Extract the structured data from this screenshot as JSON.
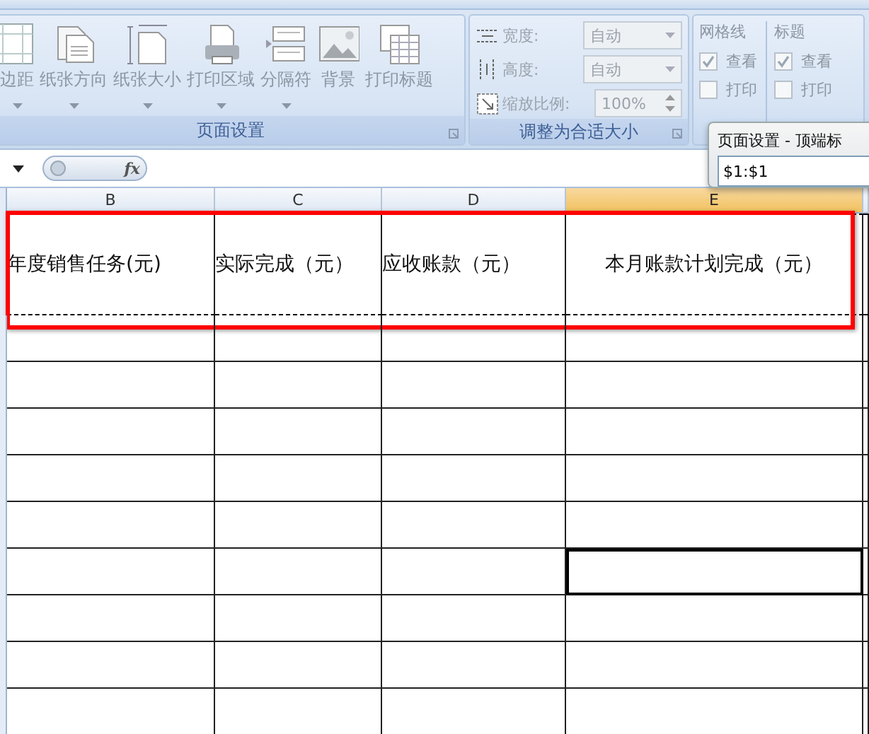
{
  "ribbon": {
    "page_setup": {
      "title": "页面设置",
      "buttons": [
        {
          "label": "边距",
          "dropdown": true
        },
        {
          "label": "纸张方向",
          "dropdown": true
        },
        {
          "label": "纸张大小",
          "dropdown": true
        },
        {
          "label": "打印区域",
          "dropdown": true
        },
        {
          "label": "分隔符",
          "dropdown": true
        },
        {
          "label": "背景",
          "dropdown": false
        },
        {
          "label": "打印标题",
          "dropdown": false
        }
      ]
    },
    "scale_to_fit": {
      "title": "调整为合适大小",
      "rows": [
        {
          "label": "宽度:",
          "value": "自动",
          "kind": "dropdown",
          "disabled": true
        },
        {
          "label": "高度:",
          "value": "自动",
          "kind": "dropdown",
          "disabled": true
        },
        {
          "label": "缩放比例:",
          "value": "100%",
          "kind": "spinner",
          "disabled": true
        }
      ]
    },
    "sheet_options": [
      {
        "title": "网格线",
        "options": [
          {
            "label": "查看",
            "checked": true
          },
          {
            "label": "打印",
            "checked": false
          }
        ]
      },
      {
        "title": "标题",
        "options": [
          {
            "label": "查看",
            "checked": true
          },
          {
            "label": "打印",
            "checked": false
          }
        ]
      }
    ]
  },
  "formula_bar": {
    "function_button": "fx"
  },
  "dialog": {
    "title": "页面设置 - 顶端标",
    "value": "$1:$1"
  },
  "sheet": {
    "columns": [
      {
        "label": "B",
        "selected": false
      },
      {
        "label": "C",
        "selected": false
      },
      {
        "label": "D",
        "selected": false
      },
      {
        "label": "E",
        "selected": true
      }
    ],
    "header_row": {
      "outlined": true,
      "print_titles": true,
      "cells": [
        "年度销售任务(元)",
        "实际完成（元）",
        "应收账款（元）",
        "本月账款计划完成（元）"
      ]
    },
    "rows": [
      {
        "cells": [
          {
            "selected": false
          },
          {
            "selected": false
          },
          {
            "selected": false
          },
          {
            "selected": false
          }
        ]
      },
      {
        "cells": [
          {
            "selected": false
          },
          {
            "selected": false
          },
          {
            "selected": false
          },
          {
            "selected": false
          }
        ]
      },
      {
        "cells": [
          {
            "selected": false
          },
          {
            "selected": false
          },
          {
            "selected": false
          },
          {
            "selected": false
          }
        ]
      },
      {
        "cells": [
          {
            "selected": false
          },
          {
            "selected": false
          },
          {
            "selected": false
          },
          {
            "selected": false
          }
        ]
      },
      {
        "cells": [
          {
            "selected": false
          },
          {
            "selected": false
          },
          {
            "selected": false
          },
          {
            "selected": false
          }
        ]
      },
      {
        "cells": [
          {
            "selected": false
          },
          {
            "selected": false
          },
          {
            "selected": false
          },
          {
            "selected": true
          }
        ]
      },
      {
        "cells": [
          {
            "selected": false
          },
          {
            "selected": false
          },
          {
            "selected": false
          },
          {
            "selected": false
          }
        ]
      },
      {
        "cells": [
          {
            "selected": false
          },
          {
            "selected": false
          },
          {
            "selected": false
          },
          {
            "selected": false
          }
        ]
      },
      {
        "cells": [
          {
            "selected": false
          },
          {
            "selected": false
          },
          {
            "selected": false
          },
          {
            "selected": false
          }
        ]
      }
    ]
  }
}
